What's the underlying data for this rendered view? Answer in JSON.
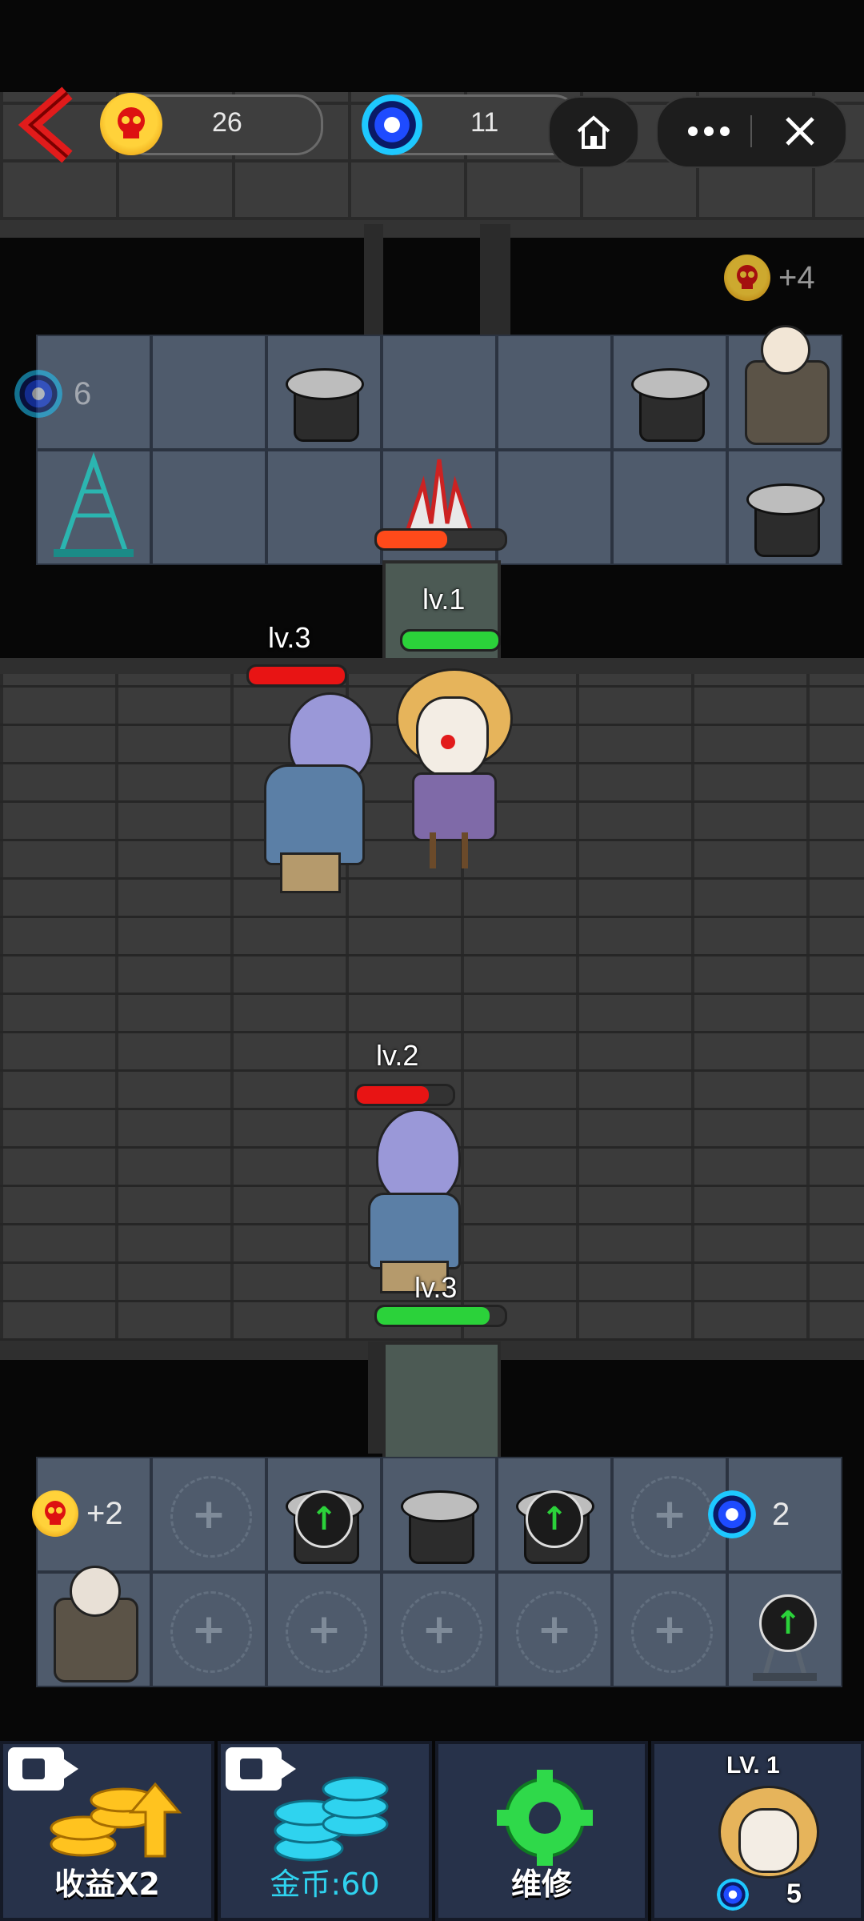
{
  "hud": {
    "skull_coins": "26",
    "portal_energy": "11"
  },
  "upper_floor": {
    "reward": "+4",
    "portal_count": "6",
    "enemy_level": "lv.1",
    "enemy_hp": 0.55
  },
  "battle": {
    "zombie_a": {
      "level": "lv.3",
      "hp": 1.0
    },
    "clown": {
      "level": "lv.1",
      "hp": 1.0
    },
    "zombie_b": {
      "level": "lv.2",
      "hp": 0.75
    },
    "door": {
      "level": "lv.3",
      "hp": 0.88
    }
  },
  "lower_floor": {
    "reward": "+2",
    "portal_count": "2"
  },
  "buttons": {
    "income": "收益X2",
    "coins": "金币:60",
    "repair": "维修",
    "hero_level": "LV. 1",
    "hero_cost": "5"
  },
  "colors": {
    "hp_red": "#e81414",
    "hp_green": "#2bd23a",
    "hp_orange": "#ff4a1a",
    "gold": "#ffc31f",
    "cyan": "#2fd3ef",
    "repair_green": "#2fd94a"
  }
}
